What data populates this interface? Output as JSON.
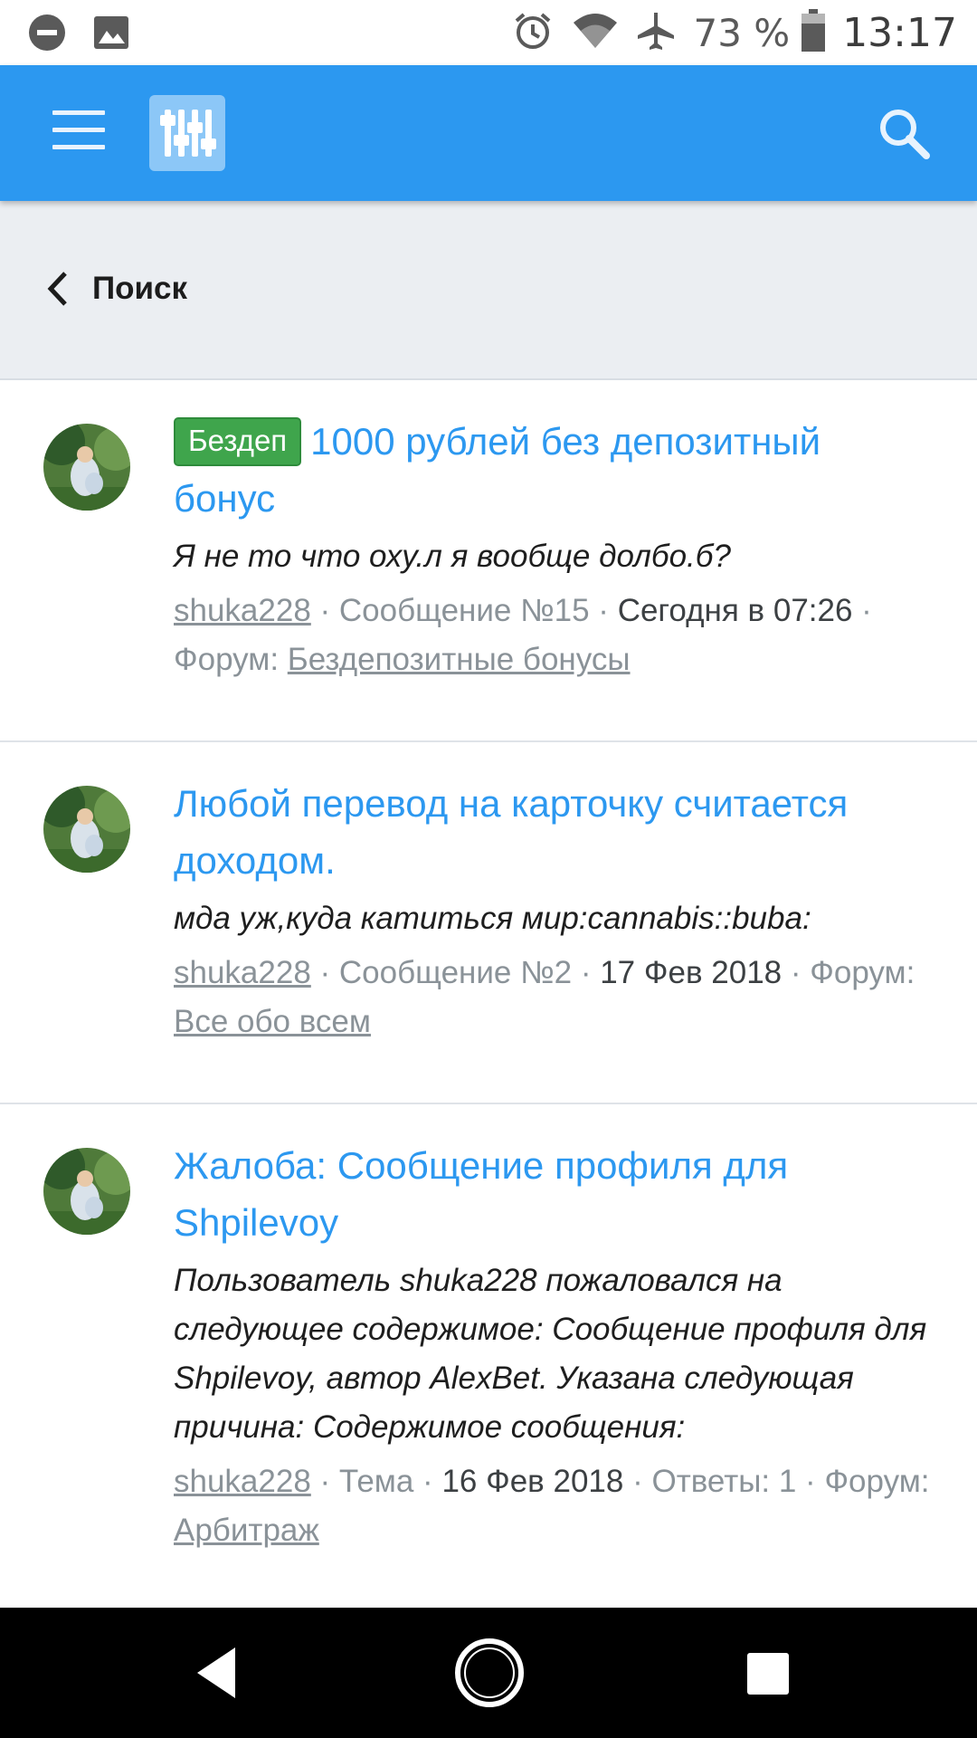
{
  "status_bar": {
    "battery_text": "73 %",
    "clock": "13:17",
    "icons": [
      "do-not-disturb-icon",
      "image-icon",
      "alarm-icon",
      "wifi-icon",
      "airplane-icon",
      "battery-icon"
    ]
  },
  "appbar": {
    "menu_icon": "menu-icon",
    "logo_icon": "sliders-logo-icon",
    "search_icon": "search-icon",
    "color": "#2c98f0"
  },
  "breadcrumb": {
    "back_label": "Поиск"
  },
  "results": [
    {
      "badge": "Бездеп",
      "title": "1000 рублей без депозитный бонус",
      "snippet": "Я не то что оху.л я вообще долбо.б?",
      "author": "shuka228",
      "sep1": " · ",
      "type": "Сообщение №15",
      "sep2": " · ",
      "date": "Сегодня в 07:26",
      "sep3": " · ",
      "forum_prefix": "Форум: ",
      "forum": "Бездепозитные бонусы"
    },
    {
      "title": "Любой перевод на карточку считается доходом.",
      "snippet": "мда уж,куда катиться мир:cannabis::buba:",
      "author": "shuka228",
      "sep1": " · ",
      "type": "Сообщение №2",
      "sep2": " · ",
      "date": "17 Фев 2018",
      "sep3": " · ",
      "forum_prefix": "Форум: ",
      "forum": "Все обо всем"
    },
    {
      "title": "Жалоба: Сообщение профиля для Shpilevoy",
      "snippet": "Пользователь shuka228 пожаловался на следующее содержимое: Сообщение профиля для Shpilevoy, автор AlexBet. Указана следующая причина: Содержимое сообщения:",
      "author": "shuka228",
      "sep1": " · ",
      "type": "Тема",
      "sep2": " · ",
      "date": "16 Фев 2018",
      "sep3": " · ",
      "replies": "Ответы: 1",
      "sep4": " · ",
      "forum_prefix": "Форум: ",
      "forum": "Арбитраж"
    }
  ],
  "navbar": {
    "icons": [
      "back-icon",
      "home-icon",
      "recents-icon"
    ]
  }
}
